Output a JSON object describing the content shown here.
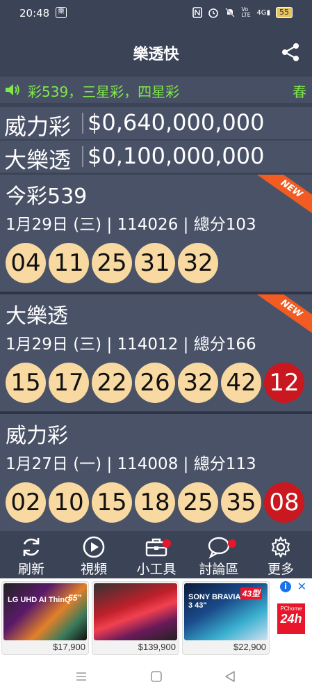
{
  "status": {
    "time": "20:48",
    "icons": [
      "nfc-icon",
      "alarm-icon",
      "mute-icon",
      "volte-icon",
      "signal-icon"
    ],
    "volte": "Vo LTE",
    "signal": "4G",
    "battery": "55"
  },
  "header": {
    "title": "樂透快"
  },
  "marquee": {
    "text": "彩539，三星彩，四星彩",
    "tail": "春"
  },
  "jackpots": [
    {
      "name": "威力彩",
      "amount": "$0,640,000,000"
    },
    {
      "name": "大樂透",
      "amount": "$0,100,000,000"
    }
  ],
  "draws": [
    {
      "game": "今彩539",
      "info": "1月29日 (三) | 114026 | 總分103",
      "numbers": [
        "04",
        "11",
        "25",
        "31",
        "32"
      ],
      "special": null,
      "badge": "NEW"
    },
    {
      "game": "大樂透",
      "info": "1月29日 (三) | 114012 | 總分166",
      "numbers": [
        "15",
        "17",
        "22",
        "26",
        "32",
        "42"
      ],
      "special": "12",
      "badge": "NEW"
    },
    {
      "game": "威力彩",
      "info": "1月27日 (一) | 114008 | 總分113",
      "numbers": [
        "02",
        "10",
        "15",
        "18",
        "25",
        "35"
      ],
      "special": "08",
      "badge": null
    }
  ],
  "nav": [
    {
      "label": "刷新",
      "icon": "refresh-icon"
    },
    {
      "label": "視頻",
      "icon": "play-icon"
    },
    {
      "label": "小工具",
      "icon": "toolbox-icon"
    },
    {
      "label": "討論區",
      "icon": "chat-icon"
    },
    {
      "label": "更多",
      "icon": "gear-icon"
    }
  ],
  "ads": [
    {
      "brand": "LG UHD AI ThinQ",
      "size": "55\"",
      "price": "$17,900"
    },
    {
      "brand": "",
      "size": "",
      "price": "$139,900"
    },
    {
      "brand": "SONY BRAVIA 3 43\"",
      "size": "43型",
      "price": "$22,900"
    }
  ],
  "ad_brand": {
    "small": "PChome",
    "big": "24h"
  },
  "colors": {
    "background": "#3b4357",
    "card": "#4a5267",
    "ball": "#f7d9a1",
    "special_ball": "#c9181f",
    "marquee_text": "#7fe84a",
    "badge": "#f25b22"
  }
}
